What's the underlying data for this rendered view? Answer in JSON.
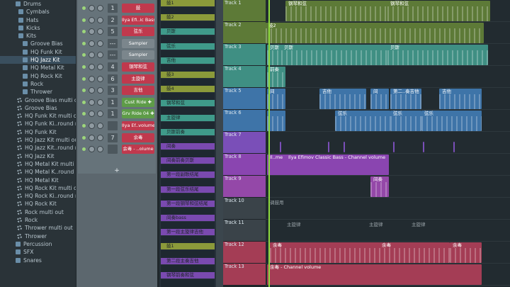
{
  "browser": {
    "items": [
      {
        "label": "Drums",
        "kind": "folder"
      },
      {
        "label": "Cymbals",
        "kind": "folder"
      },
      {
        "label": "Hats",
        "kind": "folder"
      },
      {
        "label": "Kicks",
        "kind": "folder"
      },
      {
        "label": "Kits",
        "kind": "folder"
      },
      {
        "label": "Groove Bias",
        "kind": "folder"
      },
      {
        "label": "HQ Funk Kit",
        "kind": "folder"
      },
      {
        "label": "HQ Jazz Kit",
        "kind": "folder",
        "selected": true
      },
      {
        "label": "HQ Metal Kit",
        "kind": "folder"
      },
      {
        "label": "HQ Rock Kit",
        "kind": "folder"
      },
      {
        "label": "Rock",
        "kind": "folder"
      },
      {
        "label": "Thrower",
        "kind": "folder"
      },
      {
        "label": "Groove Bias multi out",
        "kind": "preset"
      },
      {
        "label": "Groove Bias",
        "kind": "preset"
      },
      {
        "label": "HQ Funk Kit multi out",
        "kind": "preset"
      },
      {
        "label": "HQ Funk Ki..round robin",
        "kind": "preset"
      },
      {
        "label": "HQ Funk Kit",
        "kind": "preset"
      },
      {
        "label": "HQ Jazz Kit multi out",
        "kind": "preset"
      },
      {
        "label": "HQ Jazz Kit..round robin",
        "kind": "preset"
      },
      {
        "label": "HQ Jazz Kit",
        "kind": "preset"
      },
      {
        "label": "HQ Metal Kit multi out",
        "kind": "preset"
      },
      {
        "label": "HQ Metal K..round robin",
        "kind": "preset"
      },
      {
        "label": "HQ Metal Kit",
        "kind": "preset"
      },
      {
        "label": "HQ Rock Kit multi out",
        "kind": "preset"
      },
      {
        "label": "HQ Rock Ki..round robin",
        "kind": "preset"
      },
      {
        "label": "HQ Rock Kit",
        "kind": "preset"
      },
      {
        "label": "Rock multi out",
        "kind": "preset"
      },
      {
        "label": "Rock",
        "kind": "preset"
      },
      {
        "label": "Thrower multi out",
        "kind": "preset"
      },
      {
        "label": "Thrower",
        "kind": "preset"
      },
      {
        "label": "Percussion",
        "kind": "folder"
      },
      {
        "label": "SFX",
        "kind": "folder"
      },
      {
        "label": "Snares",
        "kind": "folder"
      }
    ]
  },
  "rack": {
    "channels": [
      {
        "num": "1",
        "name": "鼓",
        "color": "#c0394d"
      },
      {
        "num": "2",
        "name": "Ilya Efi..ic Bass",
        "color": "#c0394d"
      },
      {
        "num": "5",
        "name": "弦乐",
        "color": "#c0394d"
      },
      {
        "num": "---",
        "name": "Sampler",
        "color": "#7b868c"
      },
      {
        "num": "---",
        "name": "Sampler",
        "color": "#7b868c"
      },
      {
        "num": "4",
        "name": "钢琴和弦",
        "color": "#c0394d"
      },
      {
        "num": "6",
        "name": "主旋律",
        "color": "#c0394d"
      },
      {
        "num": "3",
        "name": "吉他",
        "color": "#c0394d"
      },
      {
        "num": "1",
        "name": "Cust Ride ✚",
        "color": "#5e9c48"
      },
      {
        "num": "1",
        "name": "Grv Ride 04 ✚",
        "color": "#5e9c48"
      },
      {
        "num": "",
        "name": "Ilya Ef..volume",
        "color": "#c0394d"
      },
      {
        "num": "7",
        "name": "余毒",
        "color": "#c0394d"
      },
      {
        "num": "",
        "name": "余毒 - ..olume",
        "color": "#c0394d"
      }
    ],
    "add_label": "+"
  },
  "patterns": [
    {
      "name": "鼓1",
      "color": "#8b9a3a"
    },
    {
      "name": "鼓2",
      "color": "#8b9a3a"
    },
    {
      "name": "贝斯",
      "color": "#3f9a8a"
    },
    {
      "name": "弦乐",
      "color": "#3f9a8a"
    },
    {
      "name": "吉他",
      "color": "#3f9a8a"
    },
    {
      "name": "鼓3",
      "color": "#8b9a3a"
    },
    {
      "name": "鼓4",
      "color": "#8b9a3a"
    },
    {
      "name": "钢琴和弦",
      "color": "#3f9a8a"
    },
    {
      "name": "主旋律",
      "color": "#3f9a8a"
    },
    {
      "name": "贝斯前奏",
      "color": "#3f9a8a"
    },
    {
      "name": "间奏",
      "color": "#7a4ab0"
    },
    {
      "name": "间奏前奏贝斯",
      "color": "#7a4ab0"
    },
    {
      "name": "第一段副歌结尾",
      "color": "#7a4ab0"
    },
    {
      "name": "第一段弦乐结尾",
      "color": "#7a4ab0"
    },
    {
      "name": "第一段钢琴和弦结尾",
      "color": "#7a4ab0"
    },
    {
      "name": "间奏bass",
      "color": "#7a4ab0"
    },
    {
      "name": "第一段主旋律吉他",
      "color": "#7a4ab0"
    },
    {
      "name": "鼓1",
      "color": "#8b9a3a"
    },
    {
      "name": "第二段主奏吉他",
      "color": "#7a4ab0"
    },
    {
      "name": "钢琴前奏和弦",
      "color": "#7a4ab0"
    }
  ],
  "tracks": [
    {
      "label": "Track 1",
      "color": "#5d7a37"
    },
    {
      "label": "Track 2",
      "color": "#5d7a37"
    },
    {
      "label": "Track 3",
      "color": "#3f8f83"
    },
    {
      "label": "Track 4",
      "color": "#3f8f83"
    },
    {
      "label": "Track 5",
      "color": "#3e74a8"
    },
    {
      "label": "Track 6",
      "color": "#3e74a8"
    },
    {
      "label": "Track 7",
      "color": "#7a4fb8"
    },
    {
      "label": "Track 8",
      "color": "#8a45b0"
    },
    {
      "label": "Track 9",
      "color": "#9448a8"
    },
    {
      "label": "Track 10",
      "color": "#3a4349"
    },
    {
      "label": "Track 11",
      "color": "#3a4349"
    },
    {
      "label": "Track 12",
      "color": "#a43d55"
    },
    {
      "label": "Track 13",
      "color": "#a43d55"
    }
  ],
  "clips": {
    "t1a": "钢琴和弦",
    "t1b": "钢琴和弦",
    "t2": "鼓2",
    "t3a": "贝斯",
    "t3b": "贝斯",
    "t3c": "贝斯",
    "t4": "前奏",
    "t5a": "间",
    "t5b": "吉他",
    "t5c": "间",
    "t5d": "第二..奏吉他",
    "t5e": "吉他",
    "t6a": "弦乐",
    "t6b": "弦乐",
    "t6c": "弦乐",
    "t8": "Ilya Efimov Classic Bass - Channel volume",
    "t8a": "Il..me",
    "t9": "间奏",
    "t10": "调鼓用",
    "t11a": "主旋律",
    "t11b": "主旋律",
    "t11c": "主旋律",
    "t12a": "余毒",
    "t12b": "余毒",
    "t12c": "余毒",
    "t13": "余毒 - Channel volume"
  },
  "colors": {
    "playhead": "#8fdc3e",
    "accent": "#c0394d"
  }
}
